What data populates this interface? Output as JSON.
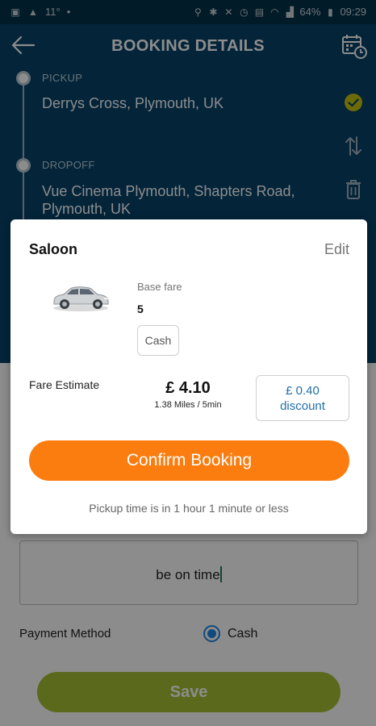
{
  "status_bar": {
    "temperature": "11°",
    "battery": "64%",
    "time": "09:29"
  },
  "header": {
    "title": "BOOKING DETAILS"
  },
  "route": {
    "pickup_label": "PICKUP",
    "pickup_value": "Derrys Cross, Plymouth, UK",
    "dropoff_label": "DROPOFF",
    "dropoff_value": "Vue Cinema Plymouth, Shapters Road, Plymouth, UK"
  },
  "modal": {
    "vehicle_name": "Saloon",
    "edit_label": "Edit",
    "base_fare_label": "Base fare",
    "base_fare_value": "5",
    "payment_chip": "Cash",
    "fare_estimate_label": "Fare Estimate",
    "fare_amount": "£ 4.10",
    "fare_distance": "1.38 Miles / 5min",
    "discount_amount": "£ 0.40",
    "discount_label": "discount",
    "confirm_label": "Confirm Booking",
    "pickup_note": "Pickup time is in 1 hour 1 minute or less"
  },
  "form": {
    "notes_value": "be on time",
    "payment_method_label": "Payment Method",
    "payment_option": "Cash",
    "save_label": "Save"
  },
  "colors": {
    "header_blue": "#074269",
    "confirm_orange": "#fb7c0f",
    "save_green": "#a7c033",
    "check_yellow": "#c6c40d",
    "radio_blue": "#1e88e5"
  },
  "icons": {
    "back": "arrow-left-icon",
    "calendar": "calendar-clock-icon",
    "confirm": "check-circle-icon",
    "swap": "swap-vertical-icon",
    "delete": "trash-icon"
  }
}
